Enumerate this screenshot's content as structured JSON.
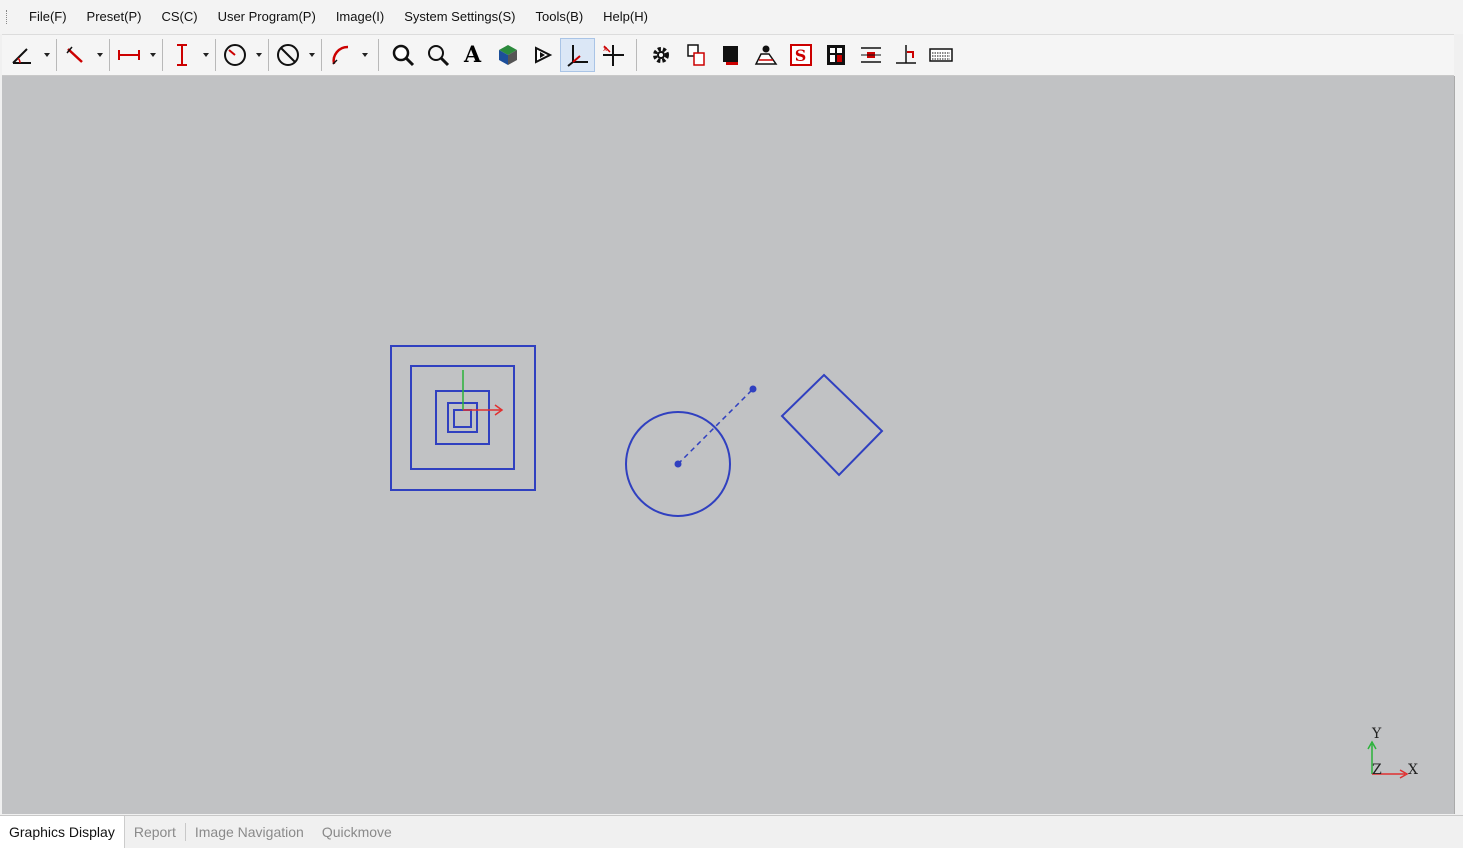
{
  "menu": {
    "items": [
      "File(F)",
      "Preset(P)",
      "CS(C)",
      "User Program(P)",
      "Image(I)",
      "System Settings(S)",
      "Tools(B)",
      "Help(H)"
    ]
  },
  "toolbar": {
    "dropdown_tools": [
      "angle-tool-icon",
      "line-tool-icon",
      "distance-tool-icon",
      "height-tool-icon",
      "circle-tool-icon",
      "circle-slash-tool-icon",
      "arc-tool-icon"
    ],
    "tools": [
      "zoom-in-icon",
      "zoom-out-icon",
      "text-tool-icon",
      "3d-view-icon",
      "probe-icon",
      "coordinate-system-icon",
      "crosshair-icon"
    ],
    "settings_tools": [
      "gear-icon",
      "copy-icon",
      "stop-icon",
      "edge-icon",
      "s-icon",
      "calculator-icon",
      "align-center-icon",
      "align-corner-icon",
      "keyboard-icon"
    ],
    "text_tool_glyph": "A",
    "s_tool_glyph": "S"
  },
  "canvas": {
    "background": "#c1c2c4",
    "shape_color": "#3040c0",
    "axis_label_y": "Y",
    "axis_label_z": "Z",
    "axis_label_x": "X"
  },
  "tabs": [
    {
      "label": "Graphics Display",
      "active": true
    },
    {
      "label": "Report",
      "active": false
    },
    {
      "label": "Image Navigation",
      "active": false
    },
    {
      "label": "Quickmove",
      "active": false
    }
  ]
}
